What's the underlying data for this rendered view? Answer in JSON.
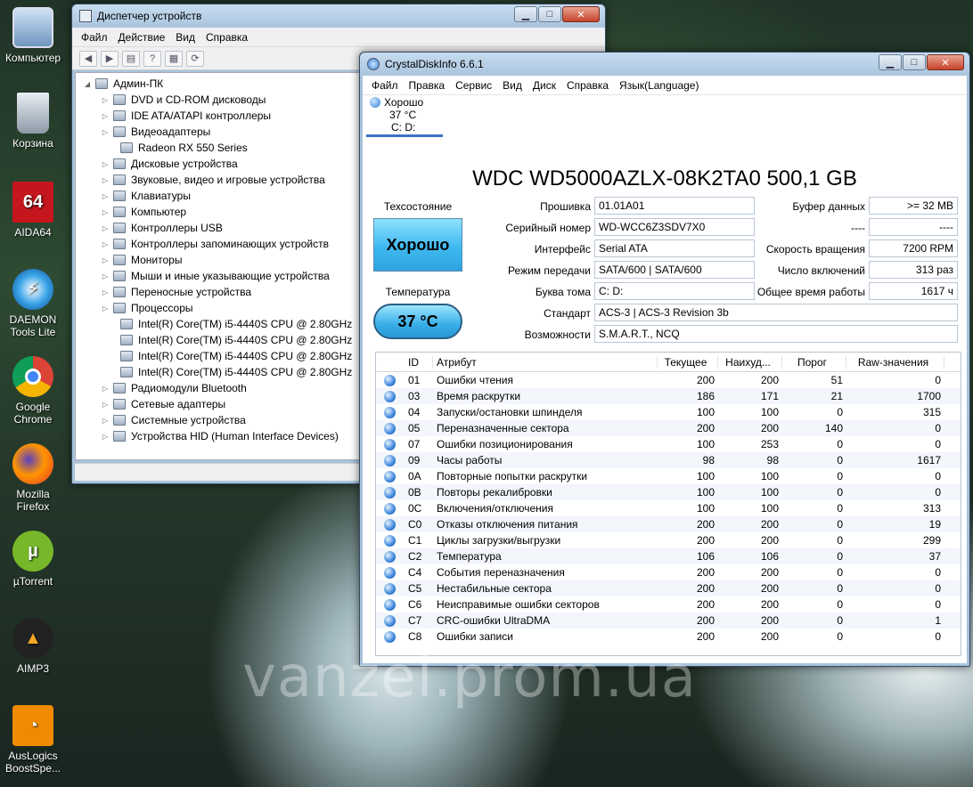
{
  "desktop": {
    "icons": [
      {
        "label": "Компьютер"
      },
      {
        "label": "Корзина"
      },
      {
        "label": "AIDA64"
      },
      {
        "label": "DAEMON Tools Lite"
      },
      {
        "label": "Google Chrome"
      },
      {
        "label": "Mozilla Firefox"
      },
      {
        "label": "µTorrent"
      },
      {
        "label": "AIMP3"
      },
      {
        "label": "AusLogics BoostSpe..."
      }
    ],
    "aida_glyph": "64",
    "watermark": "vanzel.prom.ua"
  },
  "devmgr": {
    "title": "Диспетчер устройств",
    "menu": [
      "Файл",
      "Действие",
      "Вид",
      "Справка"
    ],
    "root": "Админ-ПК",
    "nodes": [
      {
        "label": "DVD и CD-ROM дисководы",
        "level": 1
      },
      {
        "label": "IDE ATA/ATAPI контроллеры",
        "level": 1
      },
      {
        "label": "Видеоадаптеры",
        "level": 1
      },
      {
        "label": "Radeon RX 550 Series",
        "level": 2
      },
      {
        "label": "Дисковые устройства",
        "level": 1
      },
      {
        "label": "Звуковые, видео и игровые устройства",
        "level": 1
      },
      {
        "label": "Клавиатуры",
        "level": 1
      },
      {
        "label": "Компьютер",
        "level": 1
      },
      {
        "label": "Контроллеры USB",
        "level": 1
      },
      {
        "label": "Контроллеры запоминающих устройств",
        "level": 1
      },
      {
        "label": "Мониторы",
        "level": 1
      },
      {
        "label": "Мыши и иные указывающие устройства",
        "level": 1
      },
      {
        "label": "Переносные устройства",
        "level": 1
      },
      {
        "label": "Процессоры",
        "level": 1
      },
      {
        "label": "Intel(R) Core(TM) i5-4440S CPU @ 2.80GHz",
        "level": 2
      },
      {
        "label": "Intel(R) Core(TM) i5-4440S CPU @ 2.80GHz",
        "level": 2
      },
      {
        "label": "Intel(R) Core(TM) i5-4440S CPU @ 2.80GHz",
        "level": 2
      },
      {
        "label": "Intel(R) Core(TM) i5-4440S CPU @ 2.80GHz",
        "level": 2
      },
      {
        "label": "Радиомодули Bluetooth",
        "level": 1
      },
      {
        "label": "Сетевые адаптеры",
        "level": 1
      },
      {
        "label": "Системные устройства",
        "level": 1
      },
      {
        "label": "Устройства HID (Human Interface Devices)",
        "level": 1
      }
    ]
  },
  "cdi": {
    "title": "CrystalDiskInfo 6.6.1",
    "menu": [
      "Файл",
      "Правка",
      "Сервис",
      "Вид",
      "Диск",
      "Справка",
      "Язык(Language)"
    ],
    "tab": {
      "status": "Хорошо",
      "temp": "37 °C",
      "letters": "C: D:"
    },
    "drive_title": "WDC WD5000AZLX-08K2TA0 500,1 GB",
    "health_label": "Техсостояние",
    "health_value": "Хорошо",
    "temp_label": "Температура",
    "temp_value": "37 °C",
    "fields": {
      "firmware_label": "Прошивка",
      "firmware": "01.01A01",
      "serial_label": "Серийный номер",
      "serial": "WD-WCC6Z3SDV7X0",
      "interface_label": "Интерфейс",
      "interface": "Serial ATA",
      "transfer_label": "Режим передачи",
      "transfer": "SATA/600 | SATA/600",
      "letter_label": "Буква тома",
      "letter": "C: D:",
      "standard_label": "Стандарт",
      "standard": "ACS-3 | ACS-3 Revision 3b",
      "features_label": "Возможности",
      "features": "S.M.A.R.T., NCQ",
      "buffer_label": "Буфер данных",
      "buffer": ">= 32 MB",
      "blank_label": "----",
      "blank": "----",
      "rpm_label": "Скорость вращения",
      "rpm": "7200 RPM",
      "poweron_label": "Число включений",
      "poweron": "313 раз",
      "hours_label": "Общее время работы",
      "hours": "1617 ч"
    },
    "smart_headers": [
      "ID",
      "Атрибут",
      "Текущее",
      "Наихуд...",
      "Порог",
      "Raw-значения"
    ],
    "smart_rows": [
      [
        "01",
        "Ошибки чтения",
        "200",
        "200",
        "51",
        "0"
      ],
      [
        "03",
        "Время раскрутки",
        "186",
        "171",
        "21",
        "1700"
      ],
      [
        "04",
        "Запуски/остановки шпинделя",
        "100",
        "100",
        "0",
        "315"
      ],
      [
        "05",
        "Переназначенные сектора",
        "200",
        "200",
        "140",
        "0"
      ],
      [
        "07",
        "Ошибки позиционирования",
        "100",
        "253",
        "0",
        "0"
      ],
      [
        "09",
        "Часы работы",
        "98",
        "98",
        "0",
        "1617"
      ],
      [
        "0A",
        "Повторные попытки раскрутки",
        "100",
        "100",
        "0",
        "0"
      ],
      [
        "0B",
        "Повторы рекалибровки",
        "100",
        "100",
        "0",
        "0"
      ],
      [
        "0C",
        "Включения/отключения",
        "100",
        "100",
        "0",
        "313"
      ],
      [
        "C0",
        "Отказы отключения питания",
        "200",
        "200",
        "0",
        "19"
      ],
      [
        "C1",
        "Циклы загрузки/выгрузки",
        "200",
        "200",
        "0",
        "299"
      ],
      [
        "C2",
        "Температура",
        "106",
        "106",
        "0",
        "37"
      ],
      [
        "C4",
        "События переназначения",
        "200",
        "200",
        "0",
        "0"
      ],
      [
        "C5",
        "Нестабильные сектора",
        "200",
        "200",
        "0",
        "0"
      ],
      [
        "C6",
        "Неисправимые ошибки секторов",
        "200",
        "200",
        "0",
        "0"
      ],
      [
        "C7",
        "CRC-ошибки UltraDMA",
        "200",
        "200",
        "0",
        "1"
      ],
      [
        "C8",
        "Ошибки записи",
        "200",
        "200",
        "0",
        "0"
      ]
    ]
  }
}
